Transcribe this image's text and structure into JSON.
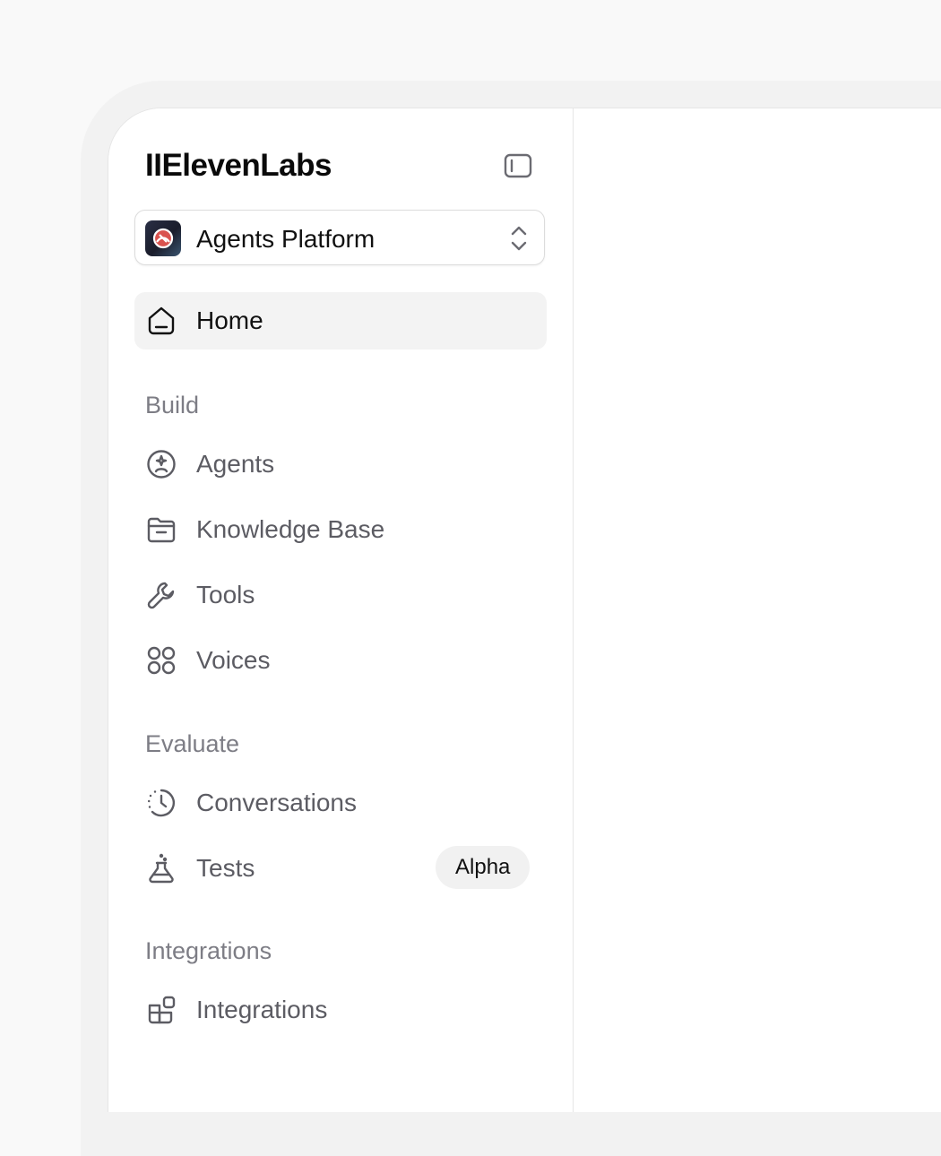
{
  "brand": {
    "name": "IIElevenLabs"
  },
  "workspace": {
    "label": "Agents Platform"
  },
  "nav": {
    "home": {
      "label": "Home",
      "icon": "home-icon"
    },
    "sections": {
      "build": "Build",
      "evaluate": "Evaluate",
      "integrations": "Integrations"
    },
    "build_items": [
      {
        "label": "Agents",
        "icon": "agent-face-icon"
      },
      {
        "label": "Knowledge Base",
        "icon": "folder-icon"
      },
      {
        "label": "Tools",
        "icon": "wrench-icon"
      },
      {
        "label": "Voices",
        "icon": "voices-grid-icon"
      }
    ],
    "evaluate_items": [
      {
        "label": "Conversations",
        "icon": "history-icon"
      },
      {
        "label": "Tests",
        "icon": "flask-icon",
        "badge": "Alpha"
      }
    ],
    "integration_items": [
      {
        "label": "Integrations",
        "icon": "blocks-icon"
      }
    ]
  },
  "colors": {
    "accent": "#111111",
    "muted_text": "#5c5c63",
    "section_text": "#7d7d85",
    "active_bg": "#f3f3f3",
    "badge_bg": "#f1f1f1"
  }
}
